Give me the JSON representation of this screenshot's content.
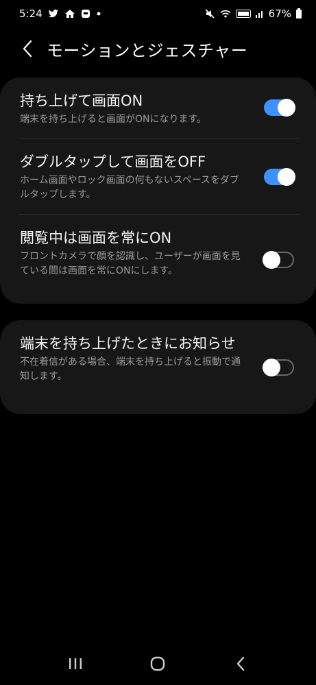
{
  "status_bar": {
    "time": "5:24",
    "battery": "67%",
    "icons_left": [
      "twitter-icon",
      "home-icon",
      "app-icon",
      "dot-icon"
    ],
    "icons_right": [
      "mute-icon",
      "wifi-icon",
      "volte-icon",
      "signal-icon",
      "battery-icon"
    ]
  },
  "header": {
    "title": "モーションとジェスチャー",
    "back_icon": "chevron-left-icon"
  },
  "settings": [
    {
      "title": "持ち上げて画面ON",
      "summary": "端末を持ち上げると画面がONになります。",
      "enabled": true
    },
    {
      "title": "ダブルタップして画面をOFF",
      "summary": "ホーム画面やロック画面の何もないスペースをダブルタップします。",
      "enabled": true
    },
    {
      "title": "閲覧中は画面を常にON",
      "summary": "フロントカメラで顔を認識し、ユーザーが画面を見ている間は画面を常にONにします。",
      "enabled": false
    },
    {
      "title": "端末を持ち上げたときにお知らせ",
      "summary": "不在着信がある場合、端末を持ち上げると振動で通知します。",
      "enabled": false
    }
  ],
  "nav_bar": {
    "recents_icon": "recents-icon",
    "home_icon": "home-button-icon",
    "back_icon": "back-arrow-icon"
  },
  "colors": {
    "accent": "#3e91ff",
    "card": "#171717",
    "background": "#000000"
  }
}
